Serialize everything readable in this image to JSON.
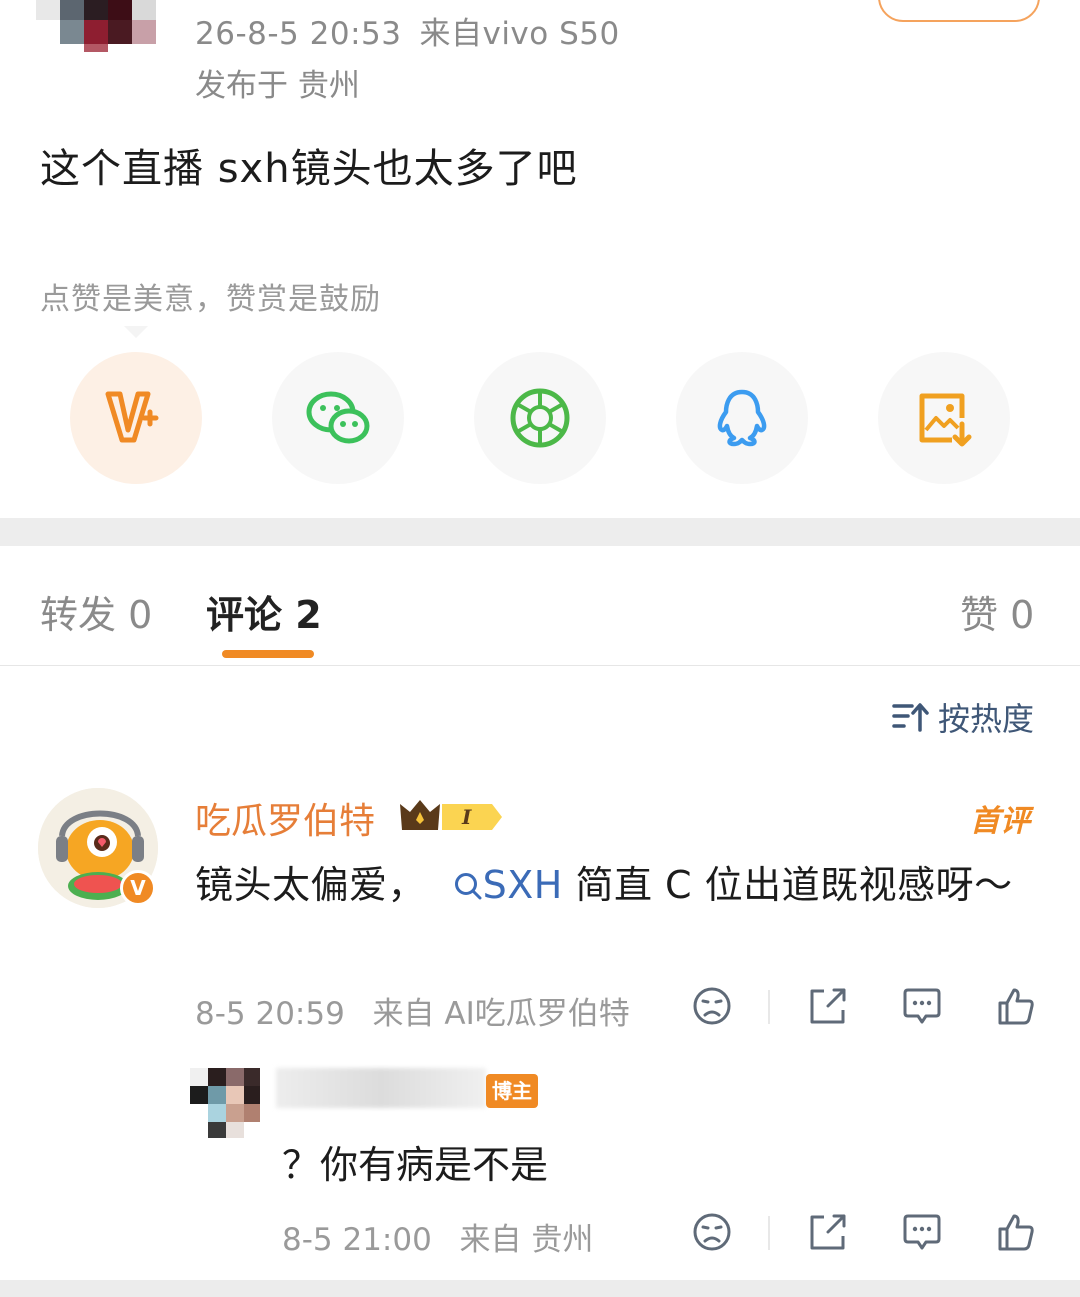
{
  "post": {
    "time": "26-8-5 20:53",
    "source": "来自vivo S50",
    "location": "发布于 贵州",
    "text": "这个直播 sxh镜头也太多了吧"
  },
  "reward_tip": "点赞是美意，赞赏是鼓励",
  "share_icons": [
    "vip-icon",
    "wechat-icon",
    "moments-icon",
    "qq-icon",
    "save-image-icon"
  ],
  "tabs": [
    {
      "label": "转发 0"
    },
    {
      "label": "评论 2"
    },
    {
      "label": "赞 0"
    }
  ],
  "sort_label": "按热度",
  "comments": [
    {
      "name": "吃瓜罗伯特",
      "level_badge": "I",
      "tag": "首评",
      "verified_badge": "V",
      "text_before": "镜头太偏爱，",
      "topic": "SXH",
      "text_after": " 简直 C 位出道既视感呀～",
      "time": "8-5 20:59",
      "source": "来自 AI吃瓜罗伯特"
    }
  ],
  "reply": {
    "owner_tag": "博主",
    "text": "？你有病是不是",
    "time": "8-5 21:00",
    "source": "来自 贵州"
  },
  "colors": {
    "accent": "#f08a24",
    "name": "#e67e38",
    "topic": "#3b6bb7",
    "wechat": "#3cc15b",
    "qq": "#3c9cf0"
  }
}
